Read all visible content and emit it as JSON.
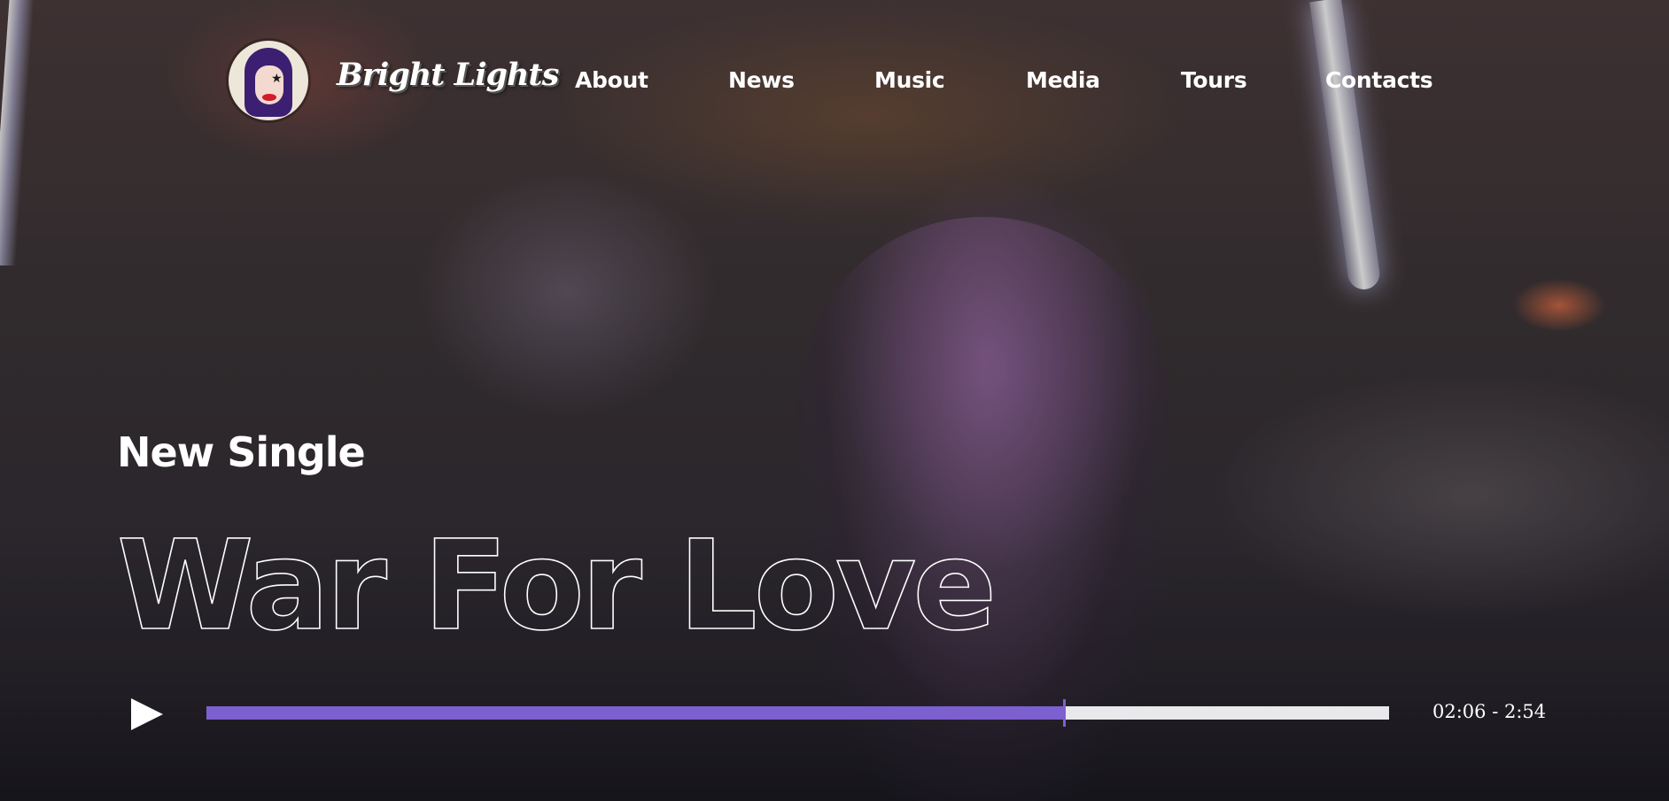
{
  "brand": {
    "name": "Bright Lights",
    "logo_icon": "singer-avatar-logo"
  },
  "nav": {
    "items": [
      {
        "label": "About"
      },
      {
        "label": "News"
      },
      {
        "label": "Music"
      },
      {
        "label": "Media"
      },
      {
        "label": "Tours"
      },
      {
        "label": "Contacts"
      }
    ]
  },
  "hero": {
    "eyebrow": "New Single",
    "title": "War For Love"
  },
  "player": {
    "play_icon": "play-icon",
    "current_time": "02:06",
    "total_time": "2:54",
    "time_display": "02:06 - 2:54",
    "progress_fraction": 0.725
  },
  "colors": {
    "accent": "#7d60cf",
    "track": "#e9e9ec",
    "text": "#ffffff"
  }
}
